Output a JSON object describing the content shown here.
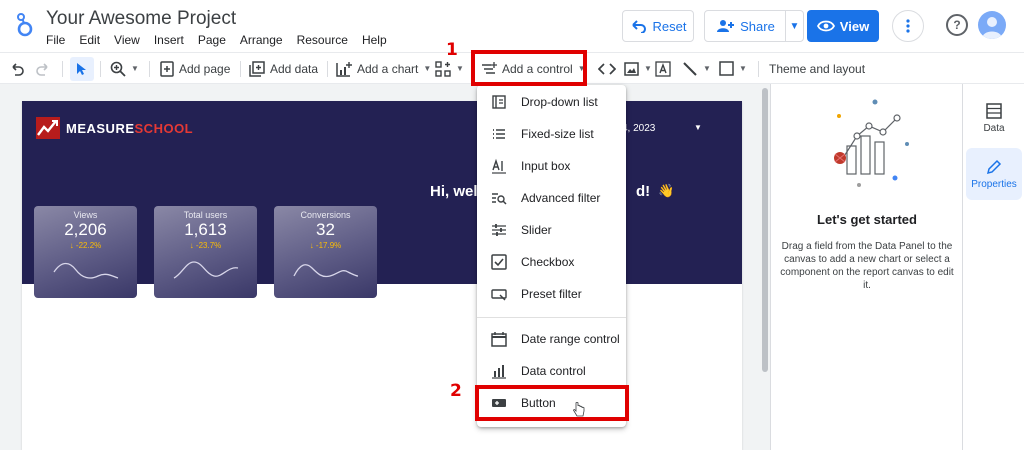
{
  "app": {
    "title": "Your Awesome Project",
    "menu": [
      "File",
      "Edit",
      "View",
      "Insert",
      "Page",
      "Arrange",
      "Resource",
      "Help"
    ]
  },
  "header_buttons": {
    "reset": "Reset",
    "share": "Share",
    "view": "View"
  },
  "toolbar": {
    "add_page": "Add page",
    "add_data": "Add data",
    "add_chart": "Add a chart",
    "add_control": "Add a control",
    "theme": "Theme and layout"
  },
  "dropdown": {
    "items": [
      {
        "label": "Drop-down list",
        "icon": "dropdown-list-icon"
      },
      {
        "label": "Fixed-size list",
        "icon": "list-icon"
      },
      {
        "label": "Input box",
        "icon": "input-box-icon"
      },
      {
        "label": "Advanced filter",
        "icon": "advanced-filter-icon"
      },
      {
        "label": "Slider",
        "icon": "slider-icon"
      },
      {
        "label": "Checkbox",
        "icon": "checkbox-icon"
      },
      {
        "label": "Preset filter",
        "icon": "preset-filter-icon"
      },
      {
        "label": "Date range control",
        "icon": "calendar-icon"
      },
      {
        "label": "Data control",
        "icon": "data-control-icon"
      },
      {
        "label": "Button",
        "icon": "button-icon"
      }
    ]
  },
  "report": {
    "brand_main": "MEASURE",
    "brand_accent": "SCHOOL",
    "date_fragment": "4, 2023",
    "greeting": "Hi, welc",
    "greeting_end": "d!",
    "kpis": [
      {
        "label": "Views",
        "value": "2,206",
        "change": "↓ -22.2%"
      },
      {
        "label": "Total users",
        "value": "1,613",
        "change": "↓ -23.7%"
      },
      {
        "label": "Conversions",
        "value": "32",
        "change": "↓ -17.9%"
      }
    ]
  },
  "properties_panel": {
    "title": "Let's get started",
    "description": "Drag a field from the Data Panel to the canvas to add a new chart or select a component on the report canvas to edit it."
  },
  "rail": {
    "data": "Data",
    "properties": "Properties"
  },
  "annotations": {
    "step1": "1",
    "step2": "2"
  },
  "colors": {
    "accent": "#1a73e8",
    "banner": "#232153",
    "highlight": "#e00000",
    "kpi_change": "#fbbc04"
  }
}
